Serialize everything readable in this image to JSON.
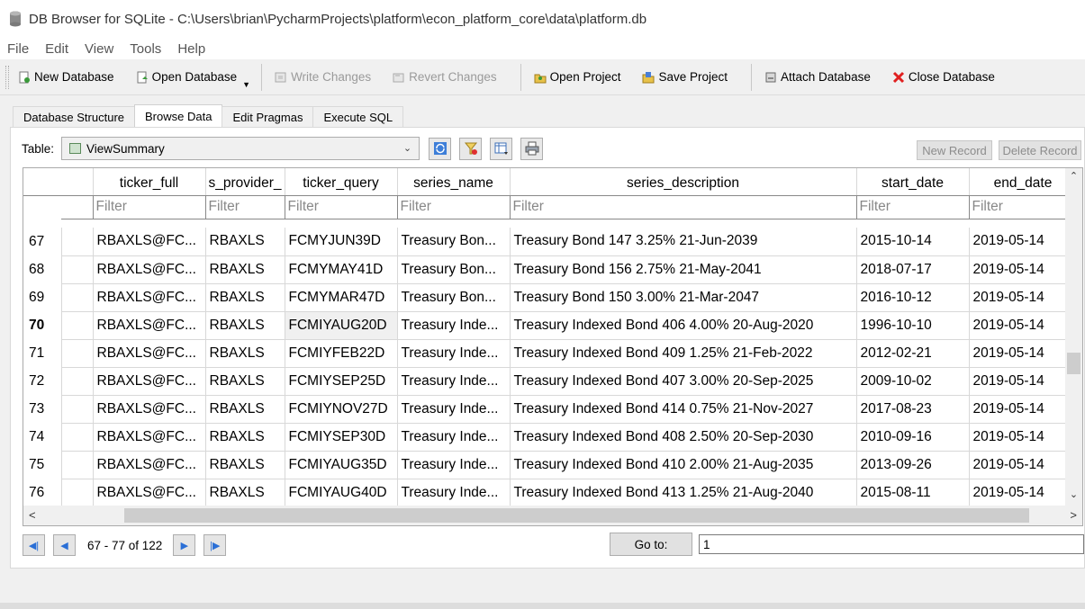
{
  "window": {
    "title": "DB Browser for SQLite - C:\\Users\\brian\\PycharmProjects\\platform\\econ_platform_core\\data\\platform.db"
  },
  "menu": [
    "File",
    "Edit",
    "View",
    "Tools",
    "Help"
  ],
  "toolbar": {
    "new_database": "New Database",
    "open_database": "Open Database",
    "write_changes": "Write Changes",
    "revert_changes": "Revert Changes",
    "open_project": "Open Project",
    "save_project": "Save Project",
    "attach_database": "Attach Database",
    "close_database": "Close Database"
  },
  "tabs": [
    "Database Structure",
    "Browse Data",
    "Edit Pragmas",
    "Execute SQL"
  ],
  "browse": {
    "table_label": "Table:",
    "table_value": "ViewSummary",
    "new_record": "New Record",
    "delete_record": "Delete Record"
  },
  "grid": {
    "columns": [
      "ticker_full",
      "s_provider_",
      "ticker_query",
      "series_name",
      "series_description",
      "start_date",
      "end_date"
    ],
    "filter_placeholder": "Filter",
    "rows": [
      {
        "n": "67",
        "c": [
          "RBAXLS@FC...",
          "RBAXLS",
          "FCMYJUN39D",
          "Treasury  Bon...",
          "Treasury Bond 147 3.25% 21-Jun-2039",
          "2015-10-14",
          "2019-05-14"
        ]
      },
      {
        "n": "68",
        "c": [
          "RBAXLS@FC...",
          "RBAXLS",
          "FCMYMAY41D",
          "Treasury  Bon...",
          "Treasury Bond 156 2.75% 21-May-2041",
          "2018-07-17",
          "2019-05-14"
        ]
      },
      {
        "n": "69",
        "c": [
          "RBAXLS@FC...",
          "RBAXLS",
          "FCMYMAR47D",
          "Treasury  Bon...",
          "Treasury Bond 150 3.00% 21-Mar-2047",
          "2016-10-12",
          "2019-05-14"
        ]
      },
      {
        "n": "70",
        "c": [
          "RBAXLS@FC...",
          "RBAXLS",
          "FCMIYAUG20D",
          "Treasury Inde...",
          "Treasury Indexed Bond 406 4.00% 20-Aug-2020",
          "1996-10-10",
          "2019-05-14"
        ]
      },
      {
        "n": "71",
        "c": [
          "RBAXLS@FC...",
          "RBAXLS",
          "FCMIYFEB22D",
          "Treasury Inde...",
          "Treasury Indexed Bond 409 1.25% 21-Feb-2022",
          "2012-02-21",
          "2019-05-14"
        ]
      },
      {
        "n": "72",
        "c": [
          "RBAXLS@FC...",
          "RBAXLS",
          "FCMIYSEP25D",
          "Treasury Inde...",
          "Treasury Indexed Bond 407 3.00% 20-Sep-2025",
          "2009-10-02",
          "2019-05-14"
        ]
      },
      {
        "n": "73",
        "c": [
          "RBAXLS@FC...",
          "RBAXLS",
          "FCMIYNOV27D",
          "Treasury Inde...",
          "Treasury Indexed Bond 414 0.75% 21-Nov-2027",
          "2017-08-23",
          "2019-05-14"
        ]
      },
      {
        "n": "74",
        "c": [
          "RBAXLS@FC...",
          "RBAXLS",
          "FCMIYSEP30D",
          "Treasury Inde...",
          "Treasury Indexed Bond 408 2.50% 20-Sep-2030",
          "2010-09-16",
          "2019-05-14"
        ]
      },
      {
        "n": "75",
        "c": [
          "RBAXLS@FC...",
          "RBAXLS",
          "FCMIYAUG35D",
          "Treasury Inde...",
          "Treasury Indexed Bond 410 2.00% 21-Aug-2035",
          "2013-09-26",
          "2019-05-14"
        ]
      },
      {
        "n": "76",
        "c": [
          "RBAXLS@FC...",
          "RBAXLS",
          "FCMIYAUG40D",
          "Treasury Inde...",
          "Treasury Indexed Bond 413 1.25% 21-Aug-2040",
          "2015-08-11",
          "2019-05-14"
        ]
      }
    ]
  },
  "pager": {
    "label": "67 - 77 of 122",
    "goto_label": "Go to:",
    "goto_value": "1"
  }
}
